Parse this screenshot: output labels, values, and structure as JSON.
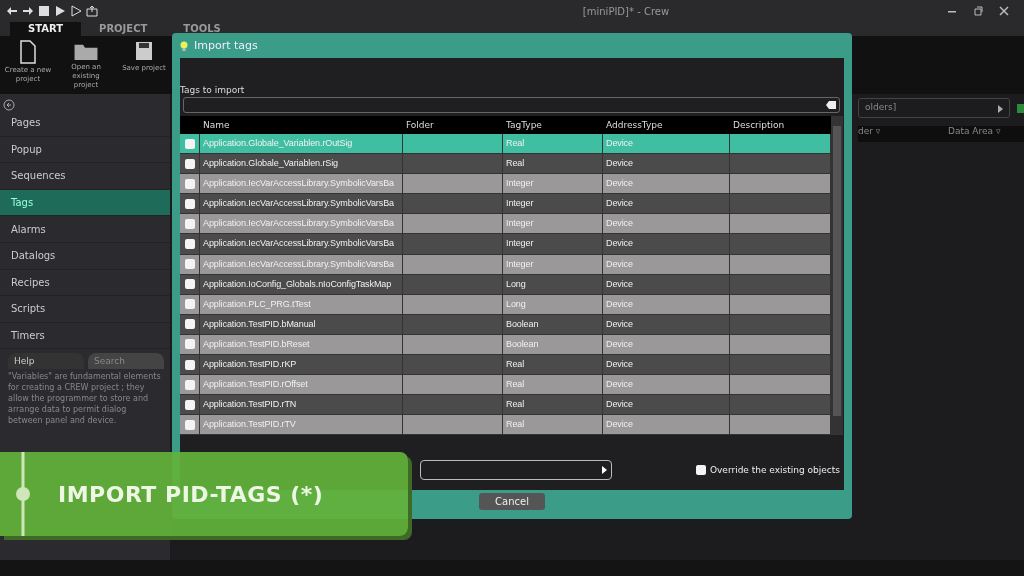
{
  "window": {
    "title": "[miniPID]* - Crew"
  },
  "ribbon_tabs": [
    {
      "label": "START",
      "selected": true
    },
    {
      "label": "PROJECT",
      "selected": false
    },
    {
      "label": "TOOLS",
      "selected": false
    }
  ],
  "ribbon_buttons": [
    "Create a new project",
    "Open an existing project",
    "Save project"
  ],
  "sidebar": {
    "items": [
      {
        "label": "Pages",
        "selected": false
      },
      {
        "label": "Popup",
        "selected": false
      },
      {
        "label": "Sequences",
        "selected": false
      },
      {
        "label": "Tags",
        "selected": true
      },
      {
        "label": "Alarms",
        "selected": false
      },
      {
        "label": "Datalogs",
        "selected": false
      },
      {
        "label": "Recipes",
        "selected": false
      },
      {
        "label": "Scripts",
        "selected": false
      },
      {
        "label": "Timers",
        "selected": false
      }
    ]
  },
  "help": {
    "tabs": [
      {
        "label": "Help",
        "selected": true
      },
      {
        "label": "Search",
        "selected": false
      }
    ],
    "text": "\"Variables\" are fundamental elements for creating a CREW project ; they allow the programmer to store and arrange data to permit dialog between panel and device."
  },
  "right_panel": {
    "folder_field": "olders]",
    "columns": [
      "der ▿",
      "Data Area ▿"
    ]
  },
  "dialog": {
    "title": "Import tags",
    "label": "Tags to import",
    "columns": [
      "Name",
      "Folder",
      "TagType",
      "AddressType",
      "Description"
    ],
    "rows": [
      {
        "name": "Application.Globale_Variablen.rOutSig",
        "type": "Real",
        "address": "Device",
        "selected": true,
        "checked": false
      },
      {
        "name": "Application.Globale_Variablen.rSig",
        "type": "Real",
        "address": "Device",
        "selected": false,
        "checked": false
      },
      {
        "name": "Application.IecVarAccessLibrary.SymbolicVarsBa",
        "type": "Integer",
        "address": "Device",
        "selected": false,
        "checked": false
      },
      {
        "name": "Application.IecVarAccessLibrary.SymbolicVarsBa",
        "type": "Integer",
        "address": "Device",
        "selected": false,
        "checked": false
      },
      {
        "name": "Application.IecVarAccessLibrary.SymbolicVarsBa",
        "type": "Integer",
        "address": "Device",
        "selected": false,
        "checked": false
      },
      {
        "name": "Application.IecVarAccessLibrary.SymbolicVarsBa",
        "type": "Integer",
        "address": "Device",
        "selected": false,
        "checked": false
      },
      {
        "name": "Application.IecVarAccessLibrary.SymbolicVarsBa",
        "type": "Integer",
        "address": "Device",
        "selected": false,
        "checked": false
      },
      {
        "name": "Application.IoConfig_Globals.nIoConfigTaskMap",
        "type": "Long",
        "address": "Device",
        "selected": false,
        "checked": false
      },
      {
        "name": "Application.PLC_PRG.tTest",
        "type": "Long",
        "address": "Device",
        "selected": false,
        "checked": false
      },
      {
        "name": "Application.TestPID.bManual",
        "type": "Boolean",
        "address": "Device",
        "selected": false,
        "checked": false
      },
      {
        "name": "Application.TestPID.bReset",
        "type": "Boolean",
        "address": "Device",
        "selected": false,
        "checked": false
      },
      {
        "name": "Application.TestPID.rKP",
        "type": "Real",
        "address": "Device",
        "selected": false,
        "checked": false
      },
      {
        "name": "Application.TestPID.rOffset",
        "type": "Real",
        "address": "Device",
        "selected": false,
        "checked": false
      },
      {
        "name": "Application.TestPID.rTN",
        "type": "Real",
        "address": "Device",
        "selected": false,
        "checked": false
      },
      {
        "name": "Application.TestPID.rTV",
        "type": "Real",
        "address": "Device",
        "selected": false,
        "checked": false
      }
    ],
    "override": {
      "label": "Override the existing objects",
      "checked": false
    },
    "cancel": "Cancel"
  },
  "banner": {
    "text": "IMPORT PID-TAGS (*)"
  }
}
